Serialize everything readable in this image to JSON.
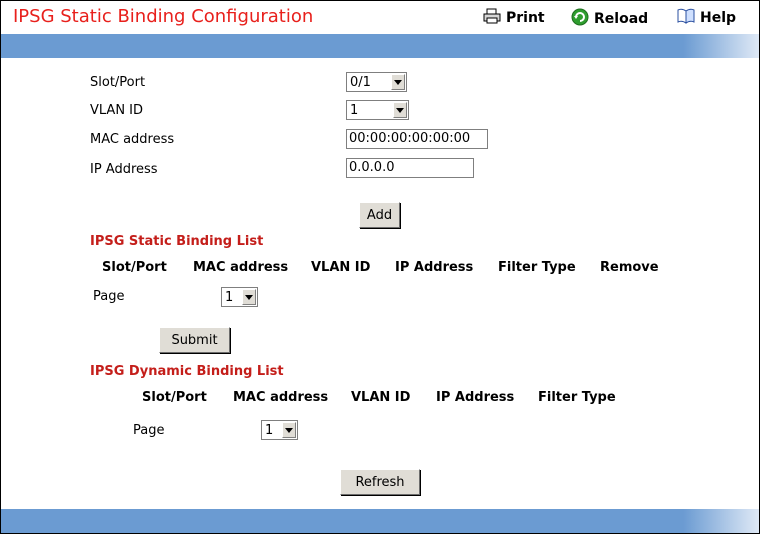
{
  "header": {
    "title": "IPSG Static Binding Configuration",
    "print_label": "Print",
    "reload_label": "Reload",
    "help_label": "Help"
  },
  "form": {
    "slot_port": {
      "label": "Slot/Port",
      "value": "0/1"
    },
    "vlan_id": {
      "label": "VLAN ID",
      "value": "1"
    },
    "mac_address": {
      "label": "MAC address",
      "value": "00:00:00:00:00:00"
    },
    "ip_address": {
      "label": "IP Address",
      "value": "0.0.0.0"
    },
    "add_label": "Add"
  },
  "static_list": {
    "title": "IPSG Static Binding List",
    "columns": [
      "Slot/Port",
      "MAC address",
      "VLAN ID",
      "IP Address",
      "Filter Type",
      "Remove"
    ],
    "page_label": "Page",
    "page_value": "1",
    "submit_label": "Submit"
  },
  "dynamic_list": {
    "title": "IPSG Dynamic Binding List",
    "columns": [
      "Slot/Port",
      "MAC address",
      "VLAN ID",
      "IP Address",
      "Filter Type"
    ],
    "page_label": "Page",
    "page_value": "1",
    "refresh_label": "Refresh"
  },
  "colors": {
    "title_red": "#e8201c",
    "section_red": "#c41e1a",
    "band_blue": "#6b9bd2",
    "button_face": "#e0ddd6"
  },
  "icons": [
    "printer-icon",
    "reload-icon",
    "help-book-icon"
  ]
}
